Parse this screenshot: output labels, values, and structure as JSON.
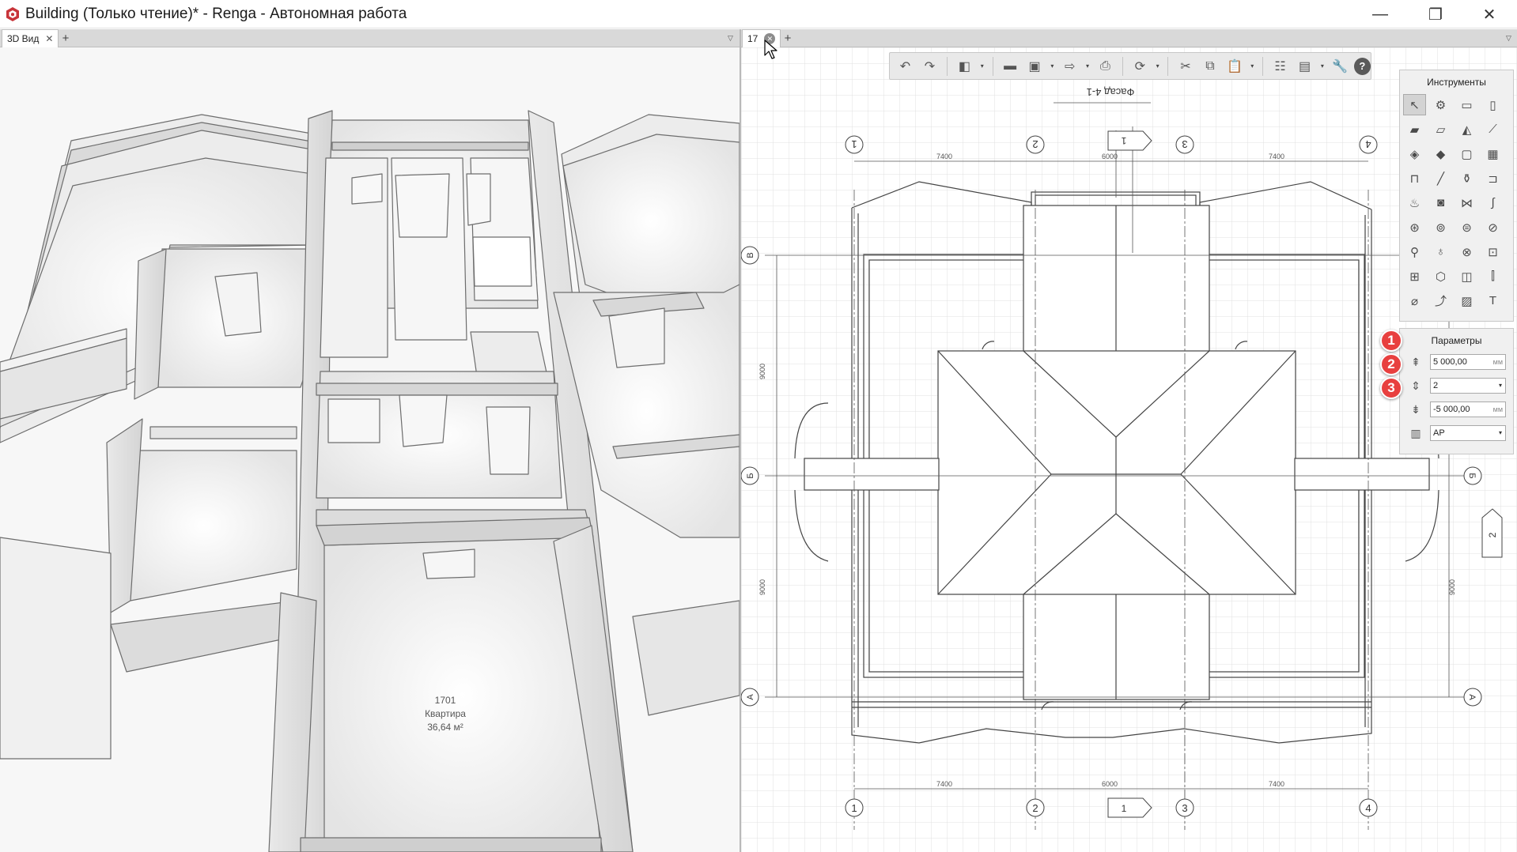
{
  "window": {
    "title": "Building (Только чтение)* - Renga - Автономная работа",
    "controls": {
      "minimize": "—",
      "maximize": "❐",
      "close": "✕"
    }
  },
  "left_tabs": [
    {
      "label": "3D Вид",
      "close": "✕"
    }
  ],
  "right_tabs": [
    {
      "label": "17",
      "close": "✕"
    }
  ],
  "tab_add": "+",
  "tab_menu": "▽",
  "room": {
    "number": "1701",
    "name": "Квартира",
    "area": "36,64 м²"
  },
  "toolbar": {
    "buttons": [
      {
        "icon": "undo-icon",
        "glyph": "↶"
      },
      {
        "icon": "redo-icon",
        "glyph": "↷"
      },
      {
        "icon": "view-cube-icon",
        "glyph": "◧"
      },
      {
        "icon": "open-folder-icon",
        "glyph": "▬"
      },
      {
        "icon": "save-icon",
        "glyph": "▣"
      },
      {
        "icon": "export-icon",
        "glyph": "⇨"
      },
      {
        "icon": "print-icon",
        "glyph": "⎙"
      },
      {
        "icon": "sync-icon",
        "glyph": "⟳"
      },
      {
        "icon": "cut-icon",
        "glyph": "✂"
      },
      {
        "icon": "copy-icon",
        "glyph": "⧉"
      },
      {
        "icon": "paste-icon",
        "glyph": "📋"
      },
      {
        "icon": "layers-icon",
        "glyph": "☷"
      },
      {
        "icon": "views-icon",
        "glyph": "▤"
      },
      {
        "icon": "settings-wrench-icon",
        "glyph": "🔧"
      },
      {
        "icon": "help-icon",
        "glyph": "?"
      }
    ],
    "dropdown": "▾"
  },
  "instruments": {
    "title": "Инструменты",
    "tools": [
      {
        "name": "select",
        "glyph": "↖"
      },
      {
        "name": "assembly",
        "glyph": "⚙"
      },
      {
        "name": "window-frame",
        "glyph": "▭"
      },
      {
        "name": "column",
        "glyph": "▯"
      },
      {
        "name": "wall",
        "glyph": "▰"
      },
      {
        "name": "beam",
        "glyph": "▱"
      },
      {
        "name": "roof",
        "glyph": "◭"
      },
      {
        "name": "stair-line",
        "glyph": "⟋"
      },
      {
        "name": "slab",
        "glyph": "◈"
      },
      {
        "name": "floor",
        "glyph": "◆"
      },
      {
        "name": "door",
        "glyph": "▢"
      },
      {
        "name": "window",
        "glyph": "▦"
      },
      {
        "name": "railing",
        "glyph": "⊓"
      },
      {
        "name": "line",
        "glyph": "╱"
      },
      {
        "name": "equipment",
        "glyph": "⚱"
      },
      {
        "name": "pipe-fitting",
        "glyph": "⊐"
      },
      {
        "name": "plumbing",
        "glyph": "♨"
      },
      {
        "name": "boiler",
        "glyph": "◙"
      },
      {
        "name": "valve",
        "glyph": "⋈"
      },
      {
        "name": "pipe",
        "glyph": "∫"
      },
      {
        "name": "pump",
        "glyph": "⊛"
      },
      {
        "name": "fan",
        "glyph": "⊚"
      },
      {
        "name": "duct-fitting",
        "glyph": "⊜"
      },
      {
        "name": "duct",
        "glyph": "⊘"
      },
      {
        "name": "lamp",
        "glyph": "⚲"
      },
      {
        "name": "lightbulb",
        "glyph": "♁"
      },
      {
        "name": "switch",
        "glyph": "⊗"
      },
      {
        "name": "socket",
        "glyph": "⊡"
      },
      {
        "name": "panel",
        "glyph": "⊞"
      },
      {
        "name": "cabinet",
        "glyph": "⬡"
      },
      {
        "name": "device",
        "glyph": "◫"
      },
      {
        "name": "terminal",
        "glyph": "⫿"
      },
      {
        "name": "dimension",
        "glyph": "⌀"
      },
      {
        "name": "level-mark",
        "glyph": "⤴"
      },
      {
        "name": "hatch",
        "glyph": "▨"
      },
      {
        "name": "text",
        "glyph": "T"
      }
    ]
  },
  "parameters": {
    "title": "Параметры",
    "rows": [
      {
        "icon": "level-offset-icon",
        "glyph": "⇞",
        "value": "5 000,00",
        "unit": "мм",
        "badge": "1"
      },
      {
        "icon": "axis-count-icon",
        "glyph": "⇕",
        "value": "2",
        "dropdown": "▾",
        "badge": "2"
      },
      {
        "icon": "elevation-icon",
        "glyph": "⇟",
        "value": "-5 000,00",
        "unit": "мм",
        "badge": "3"
      },
      {
        "icon": "style-icon",
        "glyph": "▥",
        "value": "АР",
        "dropdown": "▾"
      }
    ]
  },
  "drawing": {
    "title": "Фасад 4-1",
    "axes_columns": [
      "1",
      "2",
      "3",
      "4"
    ],
    "axes_rows": [
      "В",
      "Б",
      "А"
    ],
    "section_mark": "1",
    "section_mark_side": "2",
    "dims_top": [
      "7400",
      "6000",
      "7400"
    ],
    "dims_bottom": [
      "7400",
      "6000",
      "7400"
    ],
    "dims_side": [
      "9000",
      "9000"
    ]
  }
}
